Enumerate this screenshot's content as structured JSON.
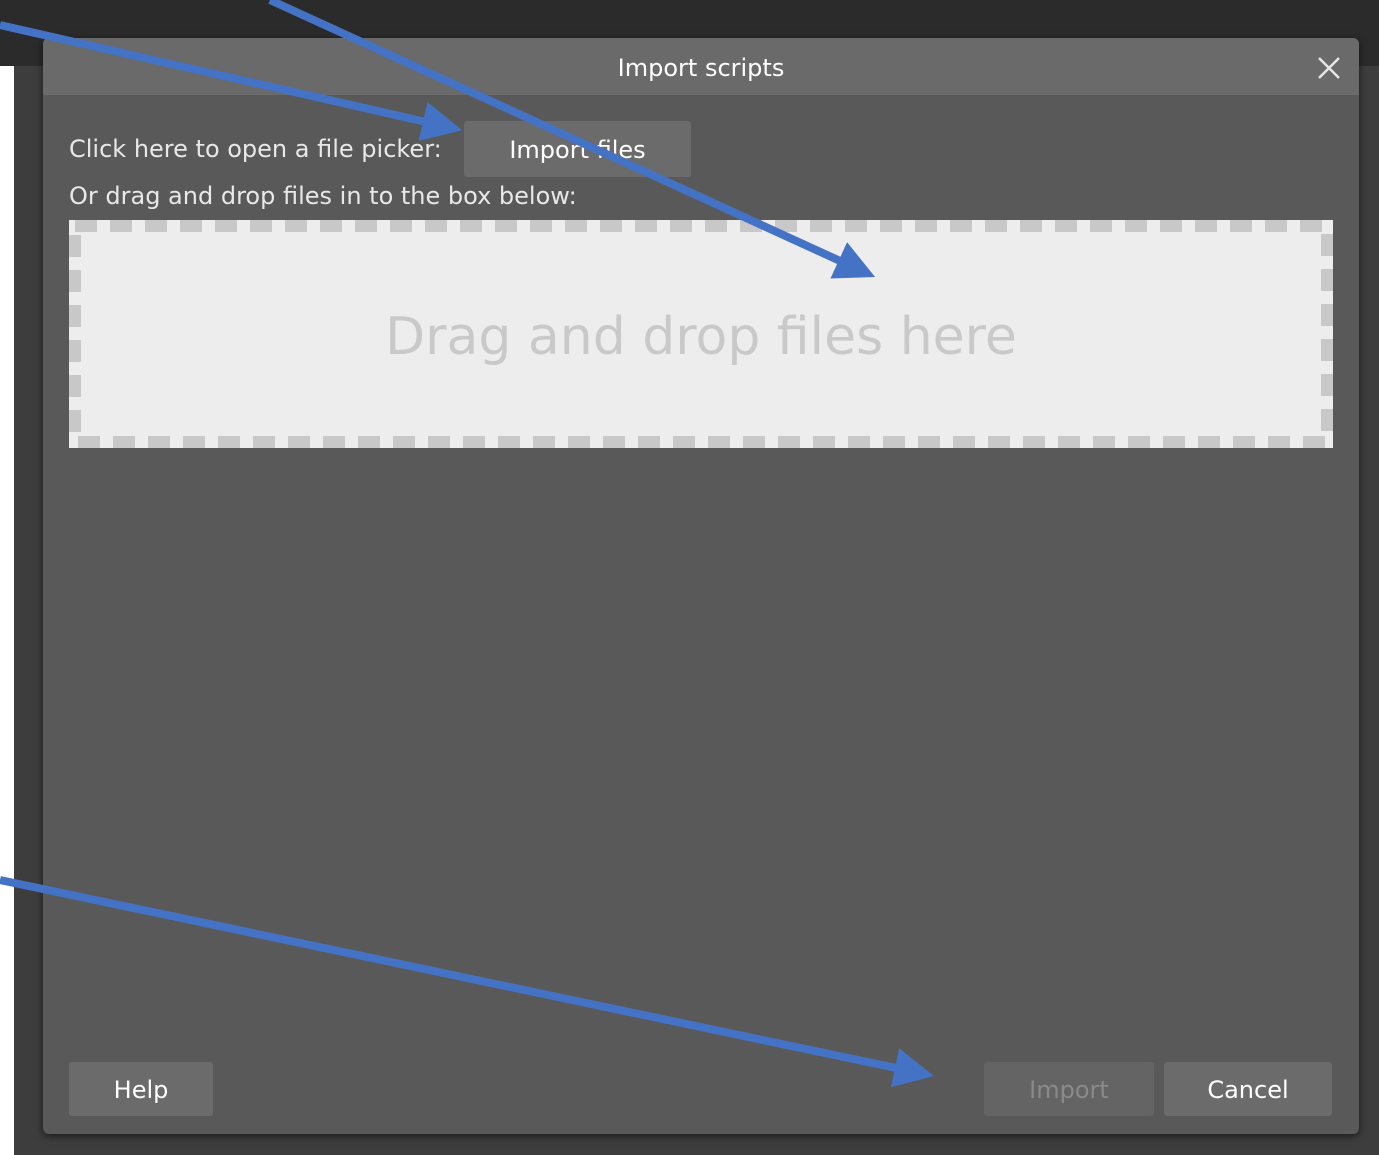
{
  "dialog": {
    "title": "Import scripts",
    "close_icon": "close-icon",
    "file_picker_instruction": "Click here to open a file picker:",
    "import_files_label": "Import files",
    "drag_instruction": "Or drag and drop files in to the box below:",
    "dropzone_label": "Drag and drop files here",
    "buttons": {
      "help": "Help",
      "import": "Import",
      "cancel": "Cancel"
    }
  },
  "annotations": {
    "arrow_color": "#4472c4"
  },
  "colors": {
    "dialog_background": "#595959",
    "titlebar_background": "#6a6a6a",
    "dropzone_background": "#ededed",
    "dropzone_border": "#c8c8c8"
  }
}
